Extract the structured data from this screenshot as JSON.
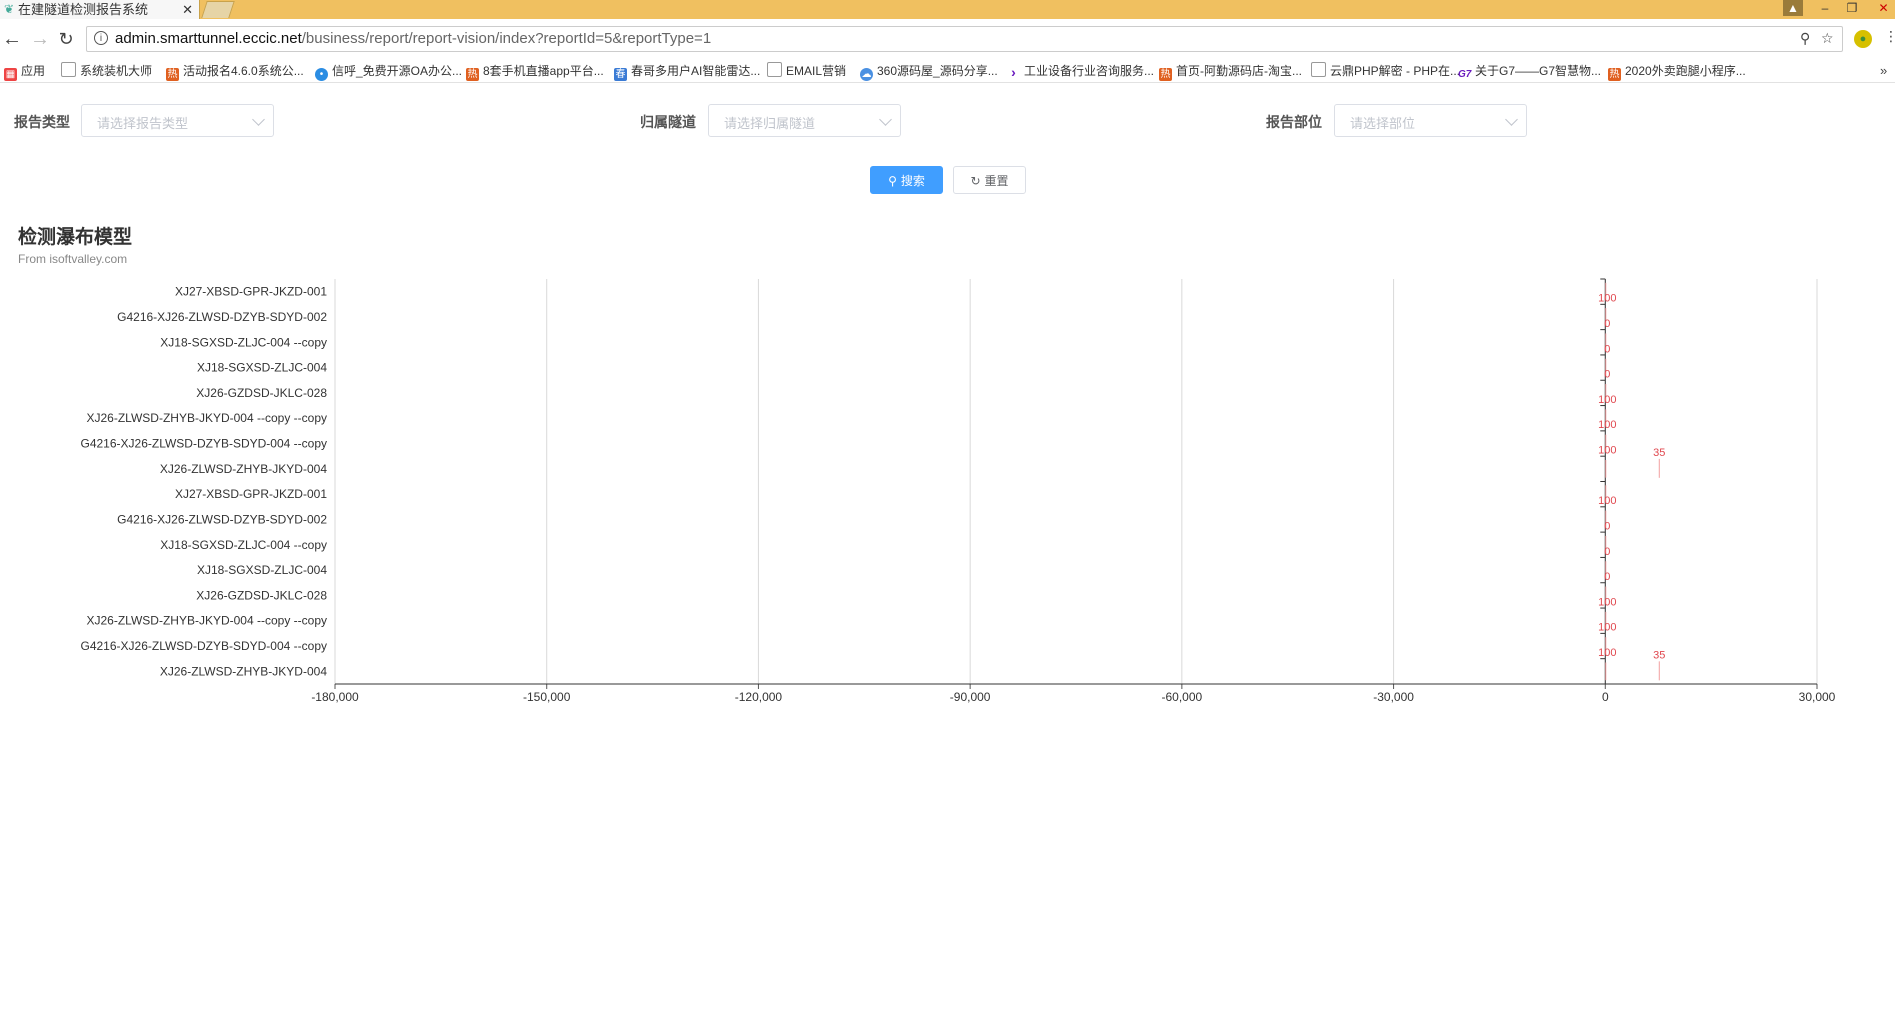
{
  "browser": {
    "tab_title": "在建隧道检测报告系统",
    "tab_close": "✕",
    "url_host": "admin.smarttunnel.eccic.net",
    "url_path": "/business/report/report-vision/index?reportId=5&reportType=1",
    "bookmarks": [
      {
        "label": "应用",
        "icon": "apps-icon",
        "color": "#e44"
      },
      {
        "label": "系统装机大师",
        "icon": "page-icon",
        "color": "#888"
      },
      {
        "label": "活动报名4.6.0系统公...",
        "icon": "brand-icon",
        "color": "#e06020"
      },
      {
        "label": "信呼_免费开源OA办公...",
        "icon": "chat-icon",
        "color": "#2b8de3"
      },
      {
        "label": "8套手机直播app平台...",
        "icon": "brand-icon",
        "color": "#e06020"
      },
      {
        "label": "春哥多用户AI智能雷达...",
        "icon": "brand-icon",
        "color": "#3a7bd5"
      },
      {
        "label": "EMAIL营销",
        "icon": "page-icon",
        "color": "#888"
      },
      {
        "label": "360源码屋_源码分享...",
        "icon": "cloud-icon",
        "color": "#4a90e2"
      },
      {
        "label": "工业设备行业咨询服务...",
        "icon": "chevron-icon",
        "color": "#6a1bbf"
      },
      {
        "label": "首页-阿勤源码店-淘宝...",
        "icon": "brand-icon",
        "color": "#e06020"
      },
      {
        "label": "云鼎PHP解密 - PHP在...",
        "icon": "page-icon",
        "color": "#888"
      },
      {
        "label": "关于G7——G7智慧物...",
        "icon": "g7-icon",
        "color": "#6a1bbf"
      },
      {
        "label": "2020外卖跑腿小程序...",
        "icon": "brand-icon",
        "color": "#e06020"
      }
    ]
  },
  "filters": {
    "report_type": {
      "label": "报告类型",
      "placeholder": "请选择报告类型"
    },
    "tunnel": {
      "label": "归属隧道",
      "placeholder": "请选择归属隧道"
    },
    "part": {
      "label": "报告部位",
      "placeholder": "请选择部位"
    }
  },
  "buttons": {
    "search": "搜索",
    "reset": "重置"
  },
  "chart": {
    "title": "检测瀑布模型",
    "subtitle": "From isoftvalley.com"
  },
  "chart_data": {
    "type": "bar",
    "orientation": "horizontal",
    "categories": [
      "XJ27-XBSD-GPR-JKZD-001",
      "G4216-XJ26-ZLWSD-DZYB-SDYD-002",
      "XJ18-SGXSD-ZLJC-004 --copy",
      "XJ18-SGXSD-ZLJC-004",
      "XJ26-GZDSD-JKLC-028",
      "XJ26-ZLWSD-ZHYB-JKYD-004 --copy --copy",
      "G4216-XJ26-ZLWSD-DZYB-SDYD-004 --copy",
      "XJ26-ZLWSD-ZHYB-JKYD-004",
      "XJ27-XBSD-GPR-JKZD-001",
      "G4216-XJ26-ZLWSD-DZYB-SDYD-002",
      "XJ18-SGXSD-ZLJC-004 --copy",
      "XJ18-SGXSD-ZLJC-004",
      "XJ26-GZDSD-JKLC-028",
      "XJ26-ZLWSD-ZHYB-JKYD-004 --copy --copy",
      "G4216-XJ26-ZLWSD-DZYB-SDYD-004 --copy",
      "XJ26-ZLWSD-ZHYB-JKYD-004"
    ],
    "series": [
      {
        "values": [
          100,
          0,
          0,
          0,
          100,
          100,
          100,
          35,
          100,
          0,
          0,
          0,
          100,
          100,
          100,
          35
        ]
      }
    ],
    "data_labels": [
      "100",
      "0",
      "0",
      "0",
      "100",
      "100",
      "100",
      "35",
      "100",
      "0",
      "0",
      "0",
      "100",
      "100",
      "100",
      "35"
    ],
    "xlim": [
      -180000,
      30000
    ],
    "xticks": [
      -180000,
      -150000,
      -120000,
      -90000,
      -60000,
      -30000,
      0,
      30000
    ],
    "xtick_labels": [
      "-180,000",
      "-150,000",
      "-120,000",
      "-90,000",
      "-60,000",
      "-30,000",
      "0",
      "30,000"
    ],
    "grid": true,
    "label_color": "#e0474e",
    "bar_color": "#f2a0a0"
  }
}
